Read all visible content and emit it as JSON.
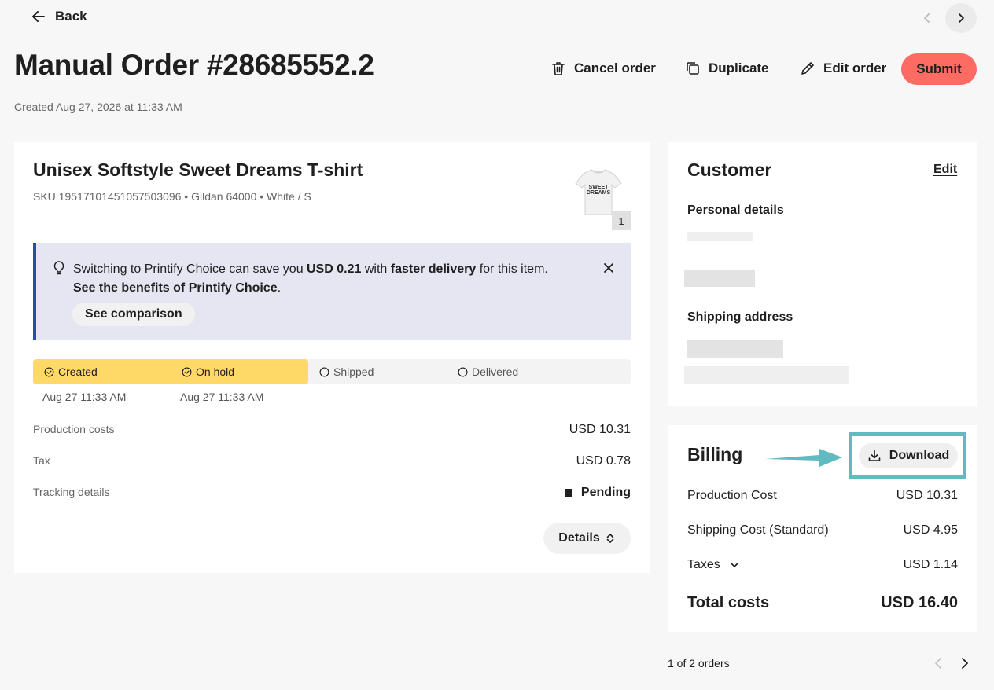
{
  "header": {
    "back_label": "Back",
    "title": "Manual Order #28685552.2",
    "created": "Created Aug 27, 2026 at 11:33 AM",
    "actions": {
      "cancel": "Cancel order",
      "duplicate": "Duplicate",
      "edit": "Edit order",
      "submit": "Submit"
    }
  },
  "product": {
    "title": "Unisex Softstyle Sweet Dreams T-shirt",
    "meta": "SKU 19517101451057503096 • Gildan 64000 • White / S",
    "quantity": "1",
    "thumb_text_1": "SWEET",
    "thumb_text_2": "DREAMS"
  },
  "promo": {
    "text_1": "Switching to Printify Choice can save you ",
    "amount": "USD 0.21",
    "text_2": " with ",
    "highlight": "faster delivery",
    "text_3": " for this item.",
    "link": "See the benefits of Printify Choice",
    "link_suffix": ".",
    "button": "See comparison"
  },
  "timeline": {
    "steps": [
      {
        "label": "Created",
        "date": "Aug 27 11:33 AM"
      },
      {
        "label": "On hold",
        "date": "Aug 27 11:33 AM"
      },
      {
        "label": "Shipped",
        "date": ""
      },
      {
        "label": "Delivered",
        "date": ""
      }
    ]
  },
  "costs": {
    "production_label": "Production costs",
    "production_value": "USD 10.31",
    "tax_label": "Tax",
    "tax_value": "USD 0.78",
    "tracking_label": "Tracking details",
    "tracking_value": "Pending",
    "details_button": "Details"
  },
  "customer": {
    "title": "Customer",
    "edit": "Edit",
    "personal_details": "Personal details",
    "shipping_address": "Shipping address"
  },
  "billing": {
    "title": "Billing",
    "download": "Download",
    "rows": [
      {
        "label": "Production Cost",
        "value": "USD 10.31"
      },
      {
        "label": "Shipping Cost (Standard)",
        "value": "USD 4.95"
      },
      {
        "label": "Taxes",
        "value": "USD 1.14"
      }
    ],
    "total_label": "Total costs",
    "total_value": "USD 16.40"
  },
  "pager": {
    "text": "1 of 2 orders"
  },
  "colors": {
    "submit": "#fe6b63",
    "timeline_active": "#fed967",
    "promo_bg": "#e6e6f3",
    "promo_accent": "#2451a6",
    "highlight": "#5fbbbf"
  }
}
